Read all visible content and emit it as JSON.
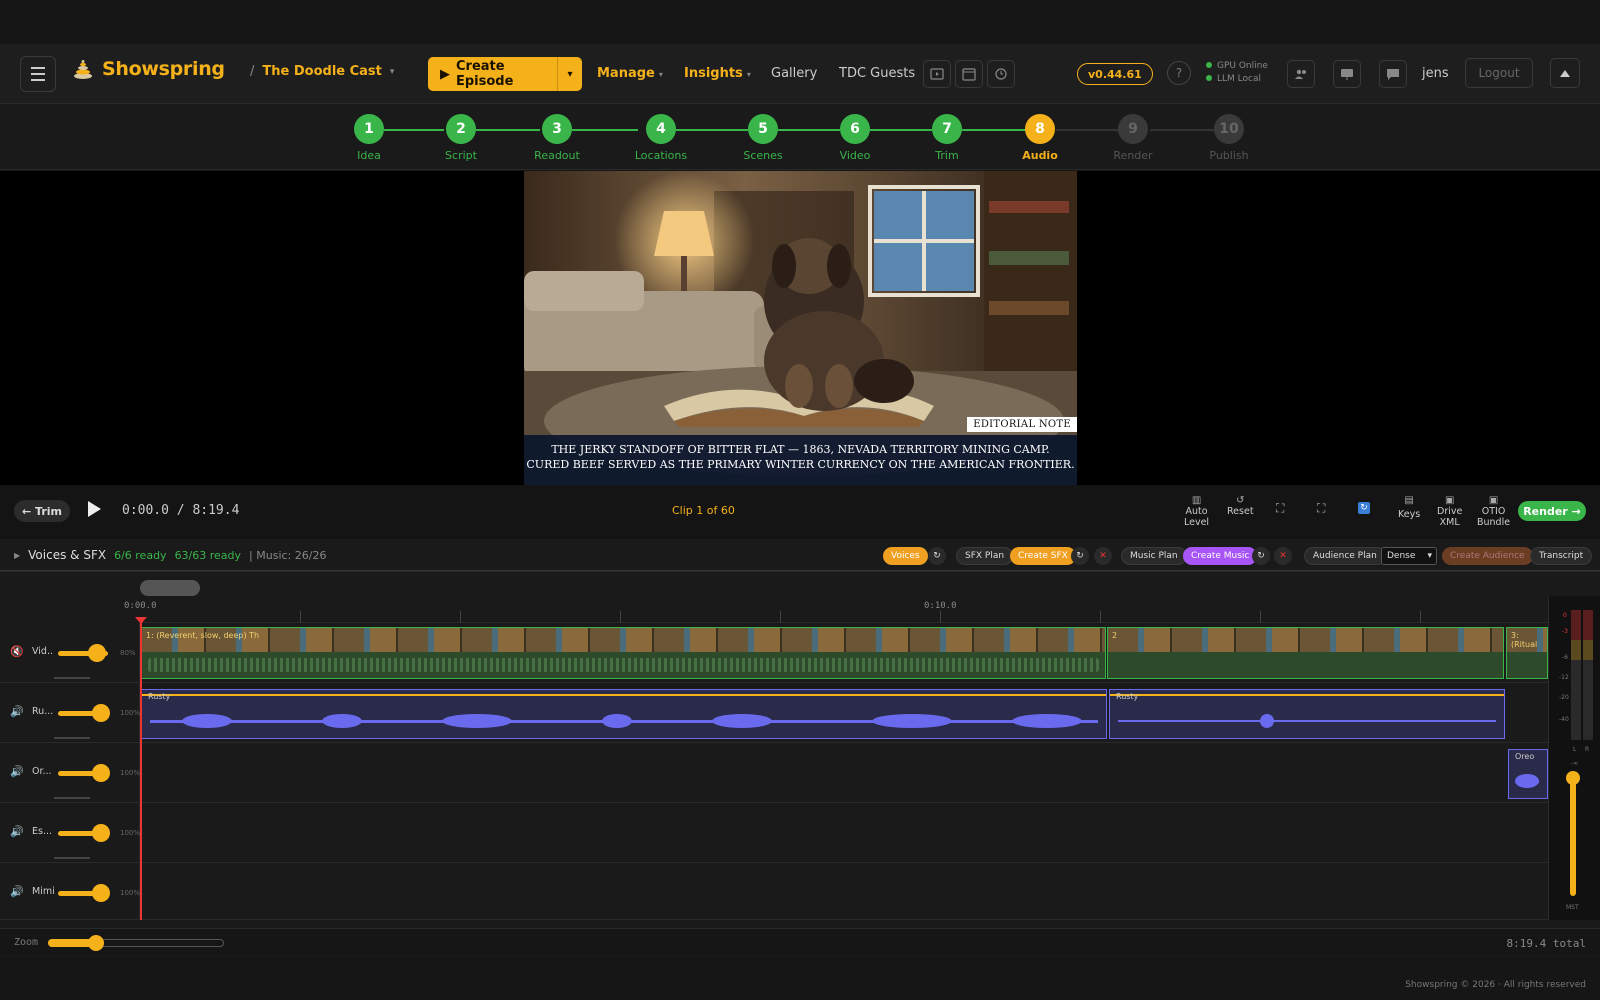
{
  "nav": {
    "brand": "Showspring",
    "show": "The Doodle Cast",
    "create_episode": "Create Episode",
    "links": [
      {
        "label": "Manage",
        "dropdown": true
      },
      {
        "label": "Insights",
        "dropdown": true
      },
      {
        "label": "Gallery",
        "dropdown": false
      },
      {
        "label": "TDC Guests",
        "dropdown": false
      }
    ],
    "version": "v0.44.61",
    "help": "?",
    "status": [
      "GPU Online",
      "LLM Local"
    ],
    "user": "jens",
    "logout": "Logout"
  },
  "steps": [
    {
      "num": "1",
      "label": "Idea",
      "state": "done"
    },
    {
      "num": "2",
      "label": "Script",
      "state": "done"
    },
    {
      "num": "3",
      "label": "Readout",
      "state": "done"
    },
    {
      "num": "4",
      "label": "Locations",
      "state": "done"
    },
    {
      "num": "5",
      "label": "Scenes",
      "state": "done"
    },
    {
      "num": "6",
      "label": "Video",
      "state": "done"
    },
    {
      "num": "7",
      "label": "Trim",
      "state": "done"
    },
    {
      "num": "8",
      "label": "Audio",
      "state": "active"
    },
    {
      "num": "9",
      "label": "Render",
      "state": "todo"
    },
    {
      "num": "10",
      "label": "Publish",
      "state": "todo"
    }
  ],
  "preview": {
    "tag": "EDITORIAL NOTE",
    "caption_line1": "THE JERKY STANDOFF OF BITTER FLAT — 1863, NEVADA TERRITORY MINING CAMP.",
    "caption_line2": "CURED BEEF SERVED AS THE PRIMARY WINTER CURRENCY ON THE AMERICAN FRONTIER."
  },
  "transport": {
    "trim": "← Trim",
    "timecode": "0:00.0 / 8:19.4",
    "clip_info": "Clip 1 of 60",
    "auto_level": [
      "Auto",
      "Level"
    ],
    "reset": "Reset",
    "keys": "Keys",
    "drive_xml": [
      "Drive",
      "XML"
    ],
    "otio": [
      "OTIO",
      "Bundle"
    ],
    "render": "Render →"
  },
  "voices_bar": {
    "title": "Voices & SFX",
    "ready1": "6/6 ready",
    "ready2": "63/63 ready",
    "music": "| Music: 26/26",
    "voices": "Voices",
    "sfx_plan": "SFX Plan",
    "create_sfx": "Create SFX",
    "music_plan": "Music Plan",
    "create_music": "Create Music",
    "audience_plan": "Audience Plan",
    "density": "Dense",
    "create_audience": "Create Audience",
    "transcript": "Transcript"
  },
  "timeline": {
    "ruler": [
      "0:00.0",
      "0:10.0"
    ],
    "tracks": [
      {
        "name": "Vid...",
        "pct": "80%",
        "volume": 0.8
      },
      {
        "name": "Ru...",
        "pct": "100%",
        "volume": 1.0
      },
      {
        "name": "Or...",
        "pct": "100%",
        "volume": 1.0
      },
      {
        "name": "Es...",
        "pct": "100%",
        "volume": 1.0
      },
      {
        "name": "Mimi",
        "pct": "100%",
        "volume": 1.0
      }
    ],
    "video_clips": [
      "1: (Reverent, slow, deep) Th",
      "2",
      "3: (Ritual"
    ],
    "audio_clips": [
      "Rusty",
      "Rusty",
      "Oreo"
    ],
    "meter_labels": [
      "0",
      "-3",
      "-6",
      "-12",
      "-20",
      "-40",
      "L",
      "R",
      "-∞",
      "MST"
    ],
    "zoom_label": "Zoom",
    "total": "8:19.4 total"
  },
  "footer": "Showspring © 2026 · All rights reserved"
}
